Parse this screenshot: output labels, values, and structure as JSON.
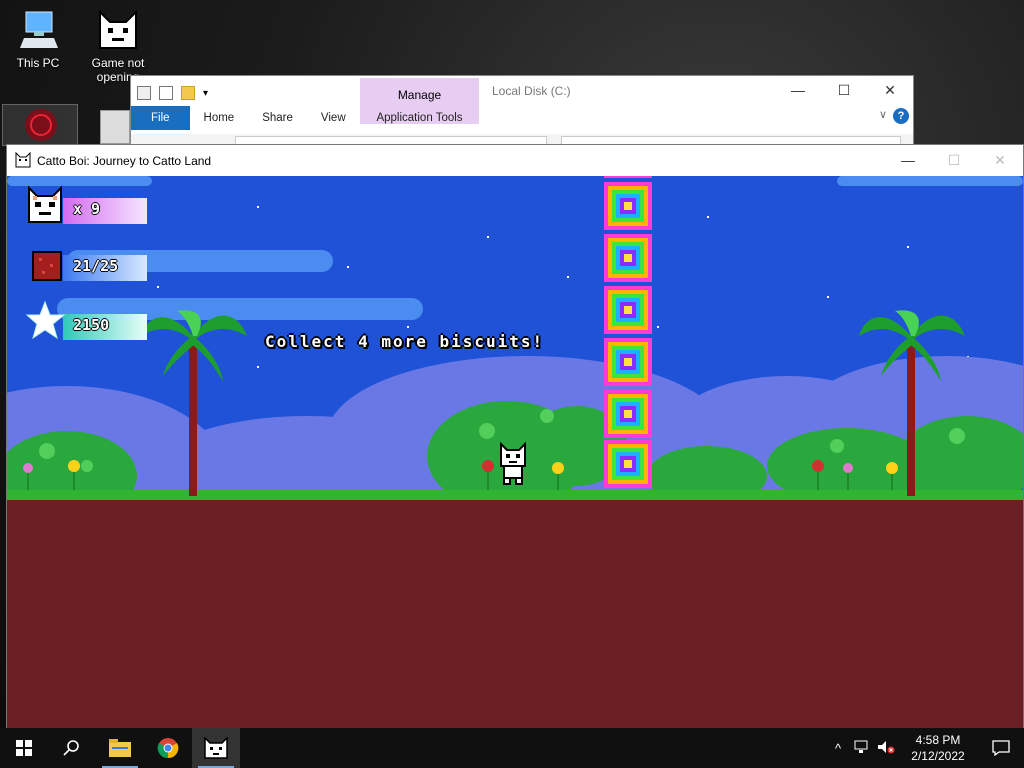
{
  "desktop": {
    "icons": [
      {
        "label": "This PC",
        "icon": "this-pc-icon"
      },
      {
        "label": "Game not opening",
        "icon": "catto-game-icon"
      }
    ]
  },
  "explorer": {
    "title": "Local Disk (C:)",
    "manage_label": "Manage",
    "ribbon_tabs": [
      "File",
      "Home",
      "Share",
      "View"
    ],
    "app_tools_label": "Application Tools",
    "controls": [
      "—",
      "☐",
      "✕"
    ],
    "help": "?",
    "chevron": "∨"
  },
  "game_window": {
    "title": "Catto Boi: Journey to Catto Land",
    "controls": [
      "—",
      "☐",
      "✕"
    ]
  },
  "hud": {
    "lives": "x 9",
    "biscuits": "21/25",
    "score": "2150"
  },
  "game_message": "Collect 4 more biscuits!",
  "colors": {
    "sky": "#1f52d6",
    "ground": "#6b1f25",
    "grass": "#2fb52f",
    "accent": "#1a6ec0"
  },
  "taskbar": {
    "time": "4:58 PM",
    "date": "2/12/2022",
    "tray_icons": [
      "^",
      "network-icon",
      "volume-muted-icon"
    ]
  }
}
